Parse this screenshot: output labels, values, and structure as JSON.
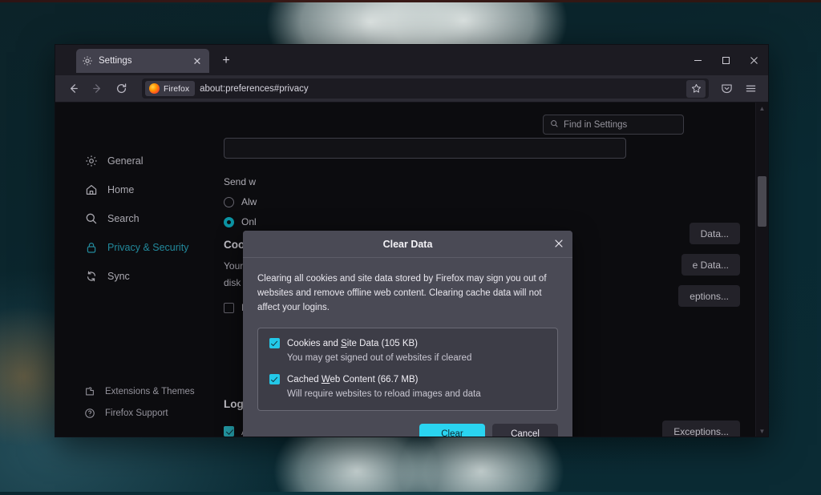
{
  "window": {
    "tab": {
      "title": "Settings",
      "favicon": "gear-icon",
      "close": "✕"
    },
    "new_tab": "+",
    "controls": {
      "minimize": "─",
      "maximize": "□",
      "close": "✕"
    }
  },
  "toolbar": {
    "back": "←",
    "forward": "→",
    "reload": "↻",
    "identity_label": "Firefox",
    "url": "about:preferences#privacy",
    "bookmark_icon": "star-icon",
    "pocket_icon": "pocket-icon",
    "menu_icon": "hamburger-menu-icon"
  },
  "search": {
    "placeholder": "Find in Settings",
    "icon": "search-icon"
  },
  "sidebar": {
    "items": [
      {
        "label": "General",
        "icon": "gear-icon",
        "active": false
      },
      {
        "label": "Home",
        "icon": "home-icon",
        "active": false
      },
      {
        "label": "Search",
        "icon": "search-icon",
        "active": false
      },
      {
        "label": "Privacy & Security",
        "icon": "lock-icon",
        "active": true
      },
      {
        "label": "Sync",
        "icon": "sync-icon",
        "active": false
      }
    ],
    "footer": [
      {
        "label": "Extensions & Themes",
        "icon": "extension-icon"
      },
      {
        "label": "Firefox Support",
        "icon": "help-icon"
      }
    ]
  },
  "prefs": {
    "do_not_track_line": "Send w",
    "radio_always": "Alw",
    "radio_only": "Onl",
    "cookies_heading": "Cooki",
    "cookies_line1": "Your st",
    "cookies_line2": "disk sp",
    "delete_checkbox_label": "De",
    "buttons": [
      "Data...",
      "e Data...",
      "eptions..."
    ],
    "logins_heading": "Logins and Passwords",
    "logins_checkbox_label": "Ask to save logins and passwords for websites",
    "logins_exceptions_button": "Exceptions..."
  },
  "dialog": {
    "title": "Clear Data",
    "close_icon": "close-icon",
    "description": "Clearing all cookies and site data stored by Firefox may sign you out of websites and remove offline web content. Clearing cache data will not affect your logins.",
    "options": [
      {
        "label_before": "Cookies and ",
        "label_key": "S",
        "label_after": "ite Data (105 KB)",
        "sub": "You may get signed out of websites if cleared",
        "checked": true
      },
      {
        "label_before": "Cached ",
        "label_key": "W",
        "label_after": "eb Content (66.7 MB)",
        "sub": "Will require websites to reload images and data",
        "checked": true
      }
    ],
    "clear_button": "Clear",
    "cancel_button": "Cancel"
  },
  "colors": {
    "accent_cyan": "#2ad4f0",
    "checkbox_cyan": "#23c8e8",
    "active_nav": "#2aa8bf",
    "dialog_bg": "#4a4a55",
    "chrome_bg": "#2b2a33",
    "content_bg": "#0f0f13"
  }
}
